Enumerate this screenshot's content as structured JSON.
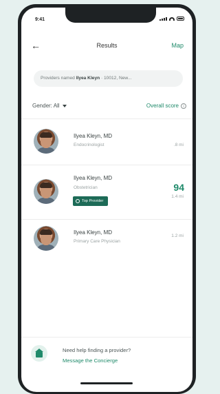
{
  "status": {
    "time": "9:41"
  },
  "header": {
    "title": "Results",
    "map_label": "Map"
  },
  "search": {
    "prefix": "Providers named ",
    "query": "Ilyea Kleyn",
    "suffix": " · 10012, New..."
  },
  "filters": {
    "gender_label": "Gender: All",
    "sort_label": "Overall score"
  },
  "providers": [
    {
      "name": "Ilyea Kleyn, MD",
      "specialty": "Endocrinologist",
      "distance": ".8 mi",
      "score": "",
      "badge": ""
    },
    {
      "name": "Ilyea Kleyn, MD",
      "specialty": "Obstetrician",
      "distance": "1.4 mi",
      "score": "94",
      "badge": "Top Provider"
    },
    {
      "name": "Ilyea Kleyn, MD",
      "specialty": "Primary Care Physician",
      "distance": "1.2 mi",
      "score": "",
      "badge": ""
    }
  ],
  "help": {
    "question": "Need help finding a provider?",
    "link": "Message the Concierge"
  },
  "colors": {
    "accent": "#1f8a6a",
    "badge_bg": "#1d6b57",
    "background": "#e6f1ef"
  }
}
